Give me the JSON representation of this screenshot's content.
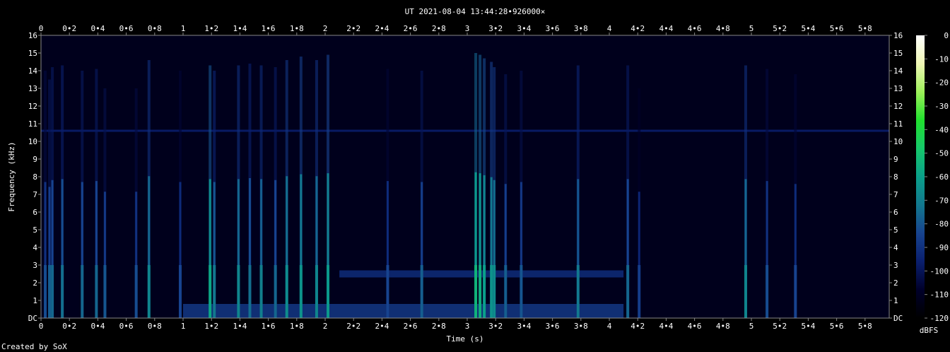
{
  "chart_data": {
    "type": "heatmap",
    "title": "UT 2021-08-04 13:44:28•926000×",
    "xlabel": "Time (s)",
    "ylabel": "Frequency (kHz)",
    "colorbar_label": "dBFS",
    "xlim": [
      0,
      5.97
    ],
    "ylim": [
      0,
      16
    ],
    "x_ticks": [
      "0",
      "0•2",
      "0•4",
      "0•6",
      "0•8",
      "1",
      "1•2",
      "1•4",
      "1•6",
      "1•8",
      "2",
      "2•2",
      "2•4",
      "2•6",
      "2•8",
      "3",
      "3•2",
      "3•4",
      "3•6",
      "3•8",
      "4",
      "4•2",
      "4•4",
      "4•6",
      "4•8",
      "5",
      "5•2",
      "5•4",
      "5•6",
      "5•8"
    ],
    "y_ticks": [
      "DC",
      "1",
      "2",
      "3",
      "4",
      "5",
      "6",
      "7",
      "8",
      "9",
      "10",
      "11",
      "12",
      "13",
      "14",
      "15",
      "16"
    ],
    "colorbar_ticks": [
      "0",
      "-10",
      "-20",
      "-30",
      "-40",
      "-50",
      "-60",
      "-70",
      "-80",
      "-90",
      "-100",
      "-110",
      "-120"
    ],
    "colorbar_range": [
      -120,
      0
    ],
    "noise_floor_dbfs": -112,
    "tone_band_khz": 10.6,
    "tone_band_dbfs": -98,
    "transients": [
      {
        "t": 0.03,
        "top_khz": 14.0,
        "dbfs": -90
      },
      {
        "t": 0.06,
        "top_khz": 13.5,
        "dbfs": -86
      },
      {
        "t": 0.08,
        "top_khz": 14.2,
        "dbfs": -84
      },
      {
        "t": 0.15,
        "top_khz": 14.3,
        "dbfs": -82
      },
      {
        "t": 0.29,
        "top_khz": 14.0,
        "dbfs": -84
      },
      {
        "t": 0.39,
        "top_khz": 14.1,
        "dbfs": -84
      },
      {
        "t": 0.45,
        "top_khz": 13.0,
        "dbfs": -88
      },
      {
        "t": 0.67,
        "top_khz": 13.0,
        "dbfs": -90
      },
      {
        "t": 0.76,
        "top_khz": 14.6,
        "dbfs": -76
      },
      {
        "t": 0.98,
        "top_khz": 14.0,
        "dbfs": -92
      },
      {
        "t": 1.19,
        "top_khz": 14.3,
        "dbfs": -66
      },
      {
        "t": 1.22,
        "top_khz": 14.0,
        "dbfs": -80
      },
      {
        "t": 1.39,
        "top_khz": 14.3,
        "dbfs": -76
      },
      {
        "t": 1.47,
        "top_khz": 14.4,
        "dbfs": -82
      },
      {
        "t": 1.55,
        "top_khz": 14.3,
        "dbfs": -78
      },
      {
        "t": 1.65,
        "top_khz": 14.2,
        "dbfs": -84
      },
      {
        "t": 1.73,
        "top_khz": 14.6,
        "dbfs": -74
      },
      {
        "t": 1.83,
        "top_khz": 14.8,
        "dbfs": -72
      },
      {
        "t": 1.94,
        "top_khz": 14.6,
        "dbfs": -76
      },
      {
        "t": 2.02,
        "top_khz": 14.9,
        "dbfs": -70
      },
      {
        "t": 2.44,
        "top_khz": 14.1,
        "dbfs": -92
      },
      {
        "t": 2.68,
        "top_khz": 14.0,
        "dbfs": -86
      },
      {
        "t": 3.06,
        "top_khz": 15.0,
        "dbfs": -62
      },
      {
        "t": 3.09,
        "top_khz": 14.9,
        "dbfs": -64
      },
      {
        "t": 3.12,
        "top_khz": 14.7,
        "dbfs": -68
      },
      {
        "t": 3.17,
        "top_khz": 14.5,
        "dbfs": -72
      },
      {
        "t": 3.19,
        "top_khz": 14.2,
        "dbfs": -74
      },
      {
        "t": 3.27,
        "top_khz": 13.8,
        "dbfs": -86
      },
      {
        "t": 3.38,
        "top_khz": 14.0,
        "dbfs": -88
      },
      {
        "t": 3.78,
        "top_khz": 14.3,
        "dbfs": -80
      },
      {
        "t": 4.13,
        "top_khz": 14.3,
        "dbfs": -84
      },
      {
        "t": 4.21,
        "top_khz": 13.0,
        "dbfs": -94
      },
      {
        "t": 4.96,
        "top_khz": 14.3,
        "dbfs": -76
      },
      {
        "t": 5.11,
        "top_khz": 14.1,
        "dbfs": -90
      },
      {
        "t": 5.31,
        "top_khz": 13.8,
        "dbfs": -92
      }
    ],
    "sustained_bands": [
      {
        "t0": 1.0,
        "t1": 4.1,
        "f0_khz": 0.0,
        "f1_khz": 0.8,
        "dbfs": -88
      },
      {
        "t0": 2.1,
        "t1": 4.1,
        "f0_khz": 2.3,
        "f1_khz": 2.7,
        "dbfs": -92
      }
    ]
  }
}
